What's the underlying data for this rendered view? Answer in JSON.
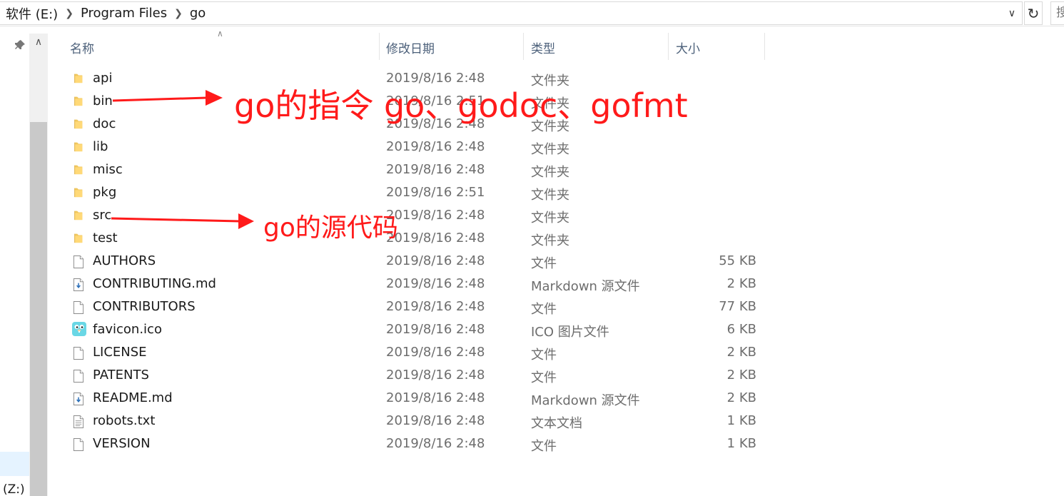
{
  "address": {
    "crumbs": [
      "软件 (E:)",
      "Program Files",
      "go"
    ],
    "search_hint": "搜"
  },
  "nav": {
    "drive_label": "(Z:)"
  },
  "columns": {
    "name": "名称",
    "date": "修改日期",
    "type": "类型",
    "size": "大小"
  },
  "files": [
    {
      "name": "api",
      "date": "2019/8/16 2:48",
      "type": "文件夹",
      "size": "",
      "icon": "folder-icon"
    },
    {
      "name": "bin",
      "date": "2019/8/16 2:51",
      "type": "文件夹",
      "size": "",
      "icon": "folder-icon"
    },
    {
      "name": "doc",
      "date": "2019/8/16 2:48",
      "type": "文件夹",
      "size": "",
      "icon": "folder-icon"
    },
    {
      "name": "lib",
      "date": "2019/8/16 2:48",
      "type": "文件夹",
      "size": "",
      "icon": "folder-icon"
    },
    {
      "name": "misc",
      "date": "2019/8/16 2:48",
      "type": "文件夹",
      "size": "",
      "icon": "folder-icon"
    },
    {
      "name": "pkg",
      "date": "2019/8/16 2:51",
      "type": "文件夹",
      "size": "",
      "icon": "folder-icon"
    },
    {
      "name": "src",
      "date": "2019/8/16 2:48",
      "type": "文件夹",
      "size": "",
      "icon": "folder-icon"
    },
    {
      "name": "test",
      "date": "2019/8/16 2:48",
      "type": "文件夹",
      "size": "",
      "icon": "folder-icon"
    },
    {
      "name": "AUTHORS",
      "date": "2019/8/16 2:48",
      "type": "文件",
      "size": "55 KB",
      "icon": "file-icon"
    },
    {
      "name": "CONTRIBUTING.md",
      "date": "2019/8/16 2:48",
      "type": "Markdown 源文件",
      "size": "2 KB",
      "icon": "markdown-file-icon"
    },
    {
      "name": "CONTRIBUTORS",
      "date": "2019/8/16 2:48",
      "type": "文件",
      "size": "77 KB",
      "icon": "file-icon"
    },
    {
      "name": "favicon.ico",
      "date": "2019/8/16 2:48",
      "type": "ICO 图片文件",
      "size": "6 KB",
      "icon": "gopher-icon"
    },
    {
      "name": "LICENSE",
      "date": "2019/8/16 2:48",
      "type": "文件",
      "size": "2 KB",
      "icon": "file-icon"
    },
    {
      "name": "PATENTS",
      "date": "2019/8/16 2:48",
      "type": "文件",
      "size": "2 KB",
      "icon": "file-icon"
    },
    {
      "name": "README.md",
      "date": "2019/8/16 2:48",
      "type": "Markdown 源文件",
      "size": "2 KB",
      "icon": "markdown-file-icon"
    },
    {
      "name": "robots.txt",
      "date": "2019/8/16 2:48",
      "type": "文本文档",
      "size": "1 KB",
      "icon": "text-file-icon"
    },
    {
      "name": "VERSION",
      "date": "2019/8/16 2:48",
      "type": "文件",
      "size": "1 KB",
      "icon": "file-icon"
    }
  ],
  "annotations": {
    "bin_note": "go的指令 go、godoc、gofmt",
    "src_note": "go的源代码"
  },
  "colors": {
    "annotation": "#ff1a1a",
    "folder": "#f0c75e",
    "header_text": "#4c607a"
  }
}
